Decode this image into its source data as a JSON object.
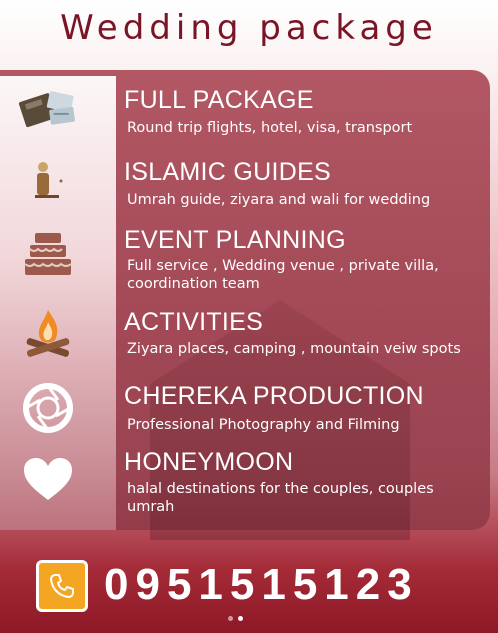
{
  "title": "Wedding package",
  "items": [
    {
      "heading": "FULL PACKAGE",
      "description": "Round trip flights, hotel, visa, transport",
      "icon": "passport-tickets-icon"
    },
    {
      "heading": "ISLAMIC GUIDES",
      "description": "Umrah guide, ziyara and wali for wedding",
      "icon": "guide-person-icon"
    },
    {
      "heading": "EVENT PLANNING",
      "description": "Full service , Wedding venue , private villa,  coordination team",
      "icon": "cake-icon"
    },
    {
      "heading": "ACTIVITIES",
      "description": "Ziyara places,  camping , mountain veiw spots",
      "icon": "campfire-icon"
    },
    {
      "heading": "CHEREKA PRODUCTION",
      "description": "Professional Photography and Filming",
      "icon": "camera-aperture-icon"
    },
    {
      "heading": "HONEYMOON",
      "description": "halal destinations for the couples, couples umrah",
      "icon": "heart-icon"
    }
  ],
  "contact": {
    "phone": "0951515123",
    "icon": "phone-icon",
    "accent": "#f4a623"
  },
  "pagination": {
    "count": 2,
    "active": 2
  },
  "colors": {
    "title": "#7a1426",
    "panel": "#a84654",
    "bottom": "#8e1826"
  }
}
